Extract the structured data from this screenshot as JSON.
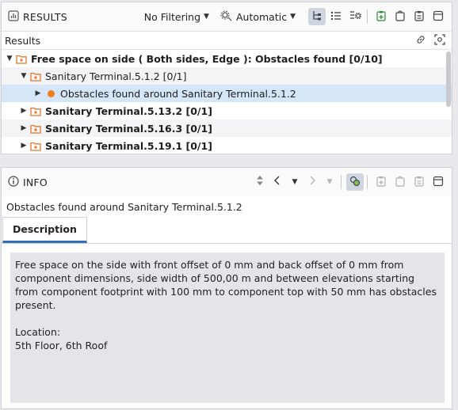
{
  "results_panel": {
    "title": "RESULTS",
    "filter_dropdown": "No Filtering",
    "mode_dropdown": "Automatic",
    "sub_header": "Results",
    "tree": [
      {
        "label": "Free space on side ( Both sides, Edge ): Obstacles found [0/10]",
        "bold": true,
        "expanded": true,
        "level": 0,
        "icon": "folder-icon"
      },
      {
        "label": "Sanitary Terminal.5.1.2 [0/1]",
        "bold": false,
        "expanded": true,
        "level": 1,
        "icon": "folder-icon"
      },
      {
        "label": "Obstacles found around Sanitary Terminal.5.1.2",
        "bold": false,
        "expanded": false,
        "level": 2,
        "icon": "issue-dot-icon",
        "selected": true
      },
      {
        "label": "Sanitary Terminal.5.13.2 [0/1]",
        "bold": true,
        "expanded": false,
        "level": 0,
        "icon": "folder-icon"
      },
      {
        "label": "Sanitary Terminal.5.16.3 [0/1]",
        "bold": true,
        "expanded": false,
        "level": 0,
        "icon": "folder-icon"
      },
      {
        "label": "Sanitary Terminal.5.19.1 [0/1]",
        "bold": true,
        "expanded": false,
        "level": 0,
        "icon": "folder-icon"
      }
    ]
  },
  "info_panel": {
    "title": "INFO",
    "summary": "Obstacles found around Sanitary Terminal.5.1.2",
    "tabs": [
      "Description"
    ],
    "description": "Free space on the side with front offset of 0 mm and back offset of 0 mm from component dimensions, side width of 500,00 m and between elevations starting from component footprint with 100 mm to component top with 50 mm has obstacles present.\n\nLocation:\n5th Floor, 6th Roof"
  },
  "colors": {
    "accent": "#2f6fb7",
    "selected_row": "#d5e6f8",
    "issue_dot": "#f07c1c",
    "folder_icon": "#e8772a"
  }
}
